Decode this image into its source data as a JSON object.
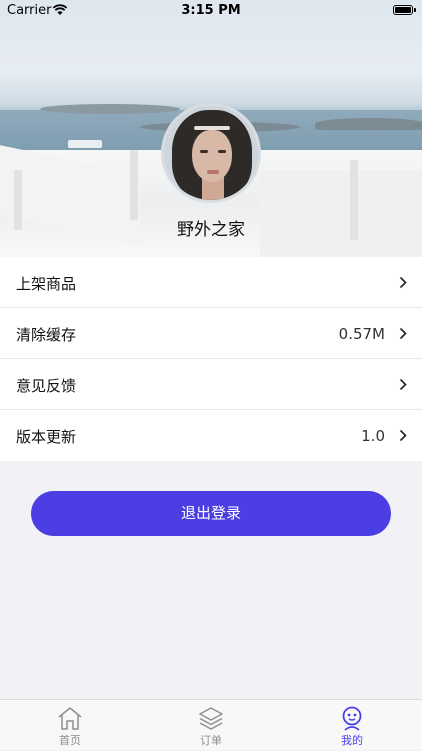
{
  "status_bar": {
    "carrier": "Carrier",
    "time": "3:15 PM"
  },
  "profile": {
    "username": "野外之家"
  },
  "menu": [
    {
      "label": "上架商品",
      "value": ""
    },
    {
      "label": "清除缓存",
      "value": "0.57M"
    },
    {
      "label": "意见反馈",
      "value": ""
    },
    {
      "label": "版本更新",
      "value": "1.0"
    }
  ],
  "logout_label": "退出登录",
  "tabs": [
    {
      "label": "首页",
      "icon": "home-icon"
    },
    {
      "label": "订单",
      "icon": "layers-icon"
    },
    {
      "label": "我的",
      "icon": "profile-icon",
      "active": true
    }
  ],
  "colors": {
    "accent": "#4b3fe4",
    "tab_inactive": "#8e8e93",
    "background": "#f2f1f6"
  }
}
